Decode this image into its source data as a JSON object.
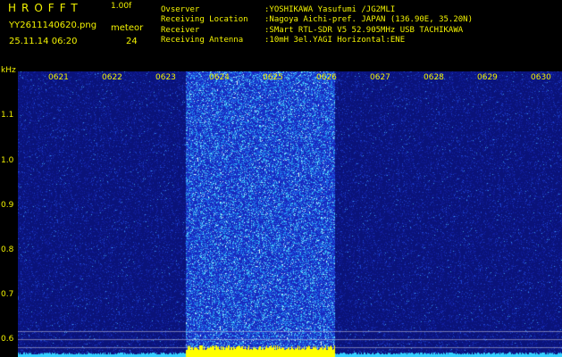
{
  "header": {
    "logo_text": "HROFFT",
    "version": "1.00f",
    "filename": "YY2611140620.png",
    "datetime": "25.11.14 06:20",
    "meteor_label": "meteor",
    "meteor_count": "24"
  },
  "info": [
    {
      "label": "Ovserver",
      "value": ":YOSHIKAWA Yasufumi /JG2MLI"
    },
    {
      "label": "Receiving Location",
      "value": ":Nagoya Aichi-pref. JAPAN (136.90E, 35.20N)"
    },
    {
      "label": "Receiver",
      "value": ":SMart RTL-SDR V5 52.905MHz USB TACHIKAWA"
    },
    {
      "label": "Receiving Antenna",
      "value": ":10mH 3el.YAGI Horizontal:ENE"
    }
  ],
  "axis": {
    "y_unit": "kHz",
    "y_ticks": [
      "1.1",
      "1.0",
      "0.9",
      "0.8",
      "0.7",
      "0.6"
    ],
    "x_ticks": [
      "0621",
      "0622",
      "0623",
      "0624",
      "0625",
      "0626",
      "0627",
      "0628",
      "0629",
      "0630"
    ]
  },
  "colors": {
    "text": "#f2f200",
    "background": "#000000",
    "waterfall_base": "#0a137a",
    "noise_band": "#2030c8",
    "baseline": "#35d0ff",
    "burst": "#ffff00"
  }
}
